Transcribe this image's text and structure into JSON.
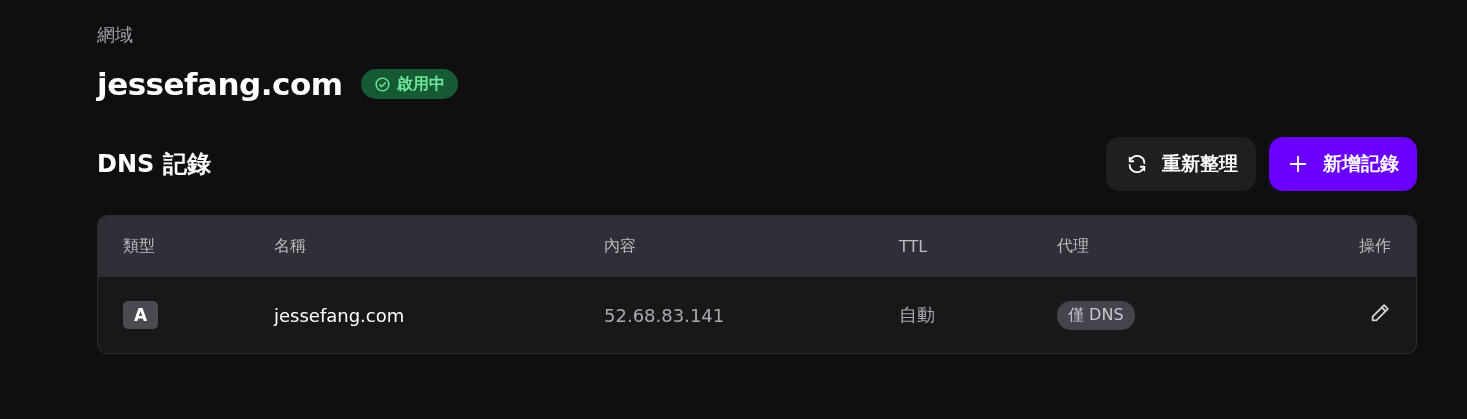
{
  "section_label": "網域",
  "domain": {
    "name": "jessefang.com",
    "status": {
      "label": "啟用中",
      "active": true
    }
  },
  "dns": {
    "title": "DNS 記錄",
    "buttons": [
      {
        "kind": "refresh",
        "label": "重新整理"
      },
      {
        "kind": "add",
        "label": "新增記錄"
      }
    ],
    "table": {
      "columns": [
        "類型",
        "名稱",
        "內容",
        "TTL",
        "代理",
        "操作"
      ],
      "rows": [
        {
          "type": "A",
          "name": "jessefang.com",
          "content": "52.68.83.141",
          "ttl": "自動",
          "proxy": "僅 DNS"
        }
      ]
    }
  }
}
